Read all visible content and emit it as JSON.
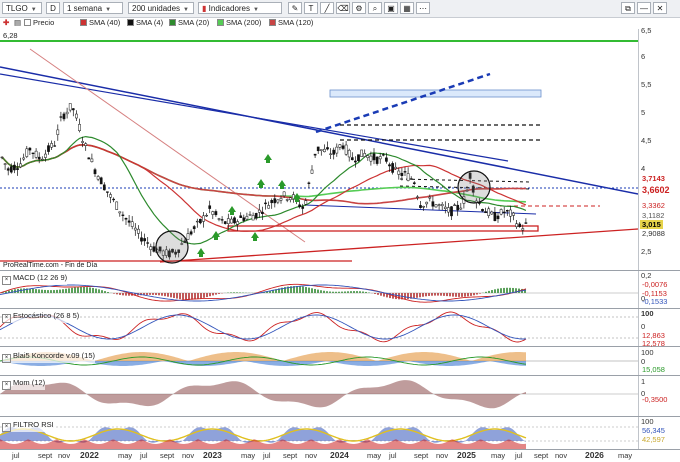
{
  "toolbar": {
    "symbol": "TLGO",
    "period_btn": "D",
    "timeframe": "1 semana",
    "units": "200 unidades",
    "indicators": "Indicadores"
  },
  "legend": [
    {
      "label": "Precio",
      "color": "#ffffff"
    },
    {
      "label": "SMA (40)",
      "color": "#cc3333"
    },
    {
      "label": "SMA (4)",
      "color": "#111111"
    },
    {
      "label": "SMA (20)",
      "color": "#2d8a2d"
    },
    {
      "label": "SMA (200)",
      "color": "#55cc55"
    },
    {
      "label": "SMA (120)",
      "color": "#c84444"
    }
  ],
  "price_label_top": "6,28",
  "source_label": "ProRealTime.com - Fin de Día",
  "right_axis_main": [
    "6,5",
    "6",
    "5,5",
    "5",
    "4,5",
    "4",
    "3,5",
    "2,5"
  ],
  "badges_main": [
    {
      "text": "3,7143",
      "color": "#ffffff",
      "textcolor": "#cc2222"
    },
    {
      "text": "3,6602",
      "color": "#ffffff",
      "textcolor": "#cc2222"
    },
    {
      "text": "3,3362",
      "color": "#ffffff",
      "textcolor": "#cc2222"
    },
    {
      "text": "3,1182",
      "color": "#ffffff",
      "textcolor": "#555555"
    },
    {
      "text": "3,015",
      "color": "#e6d34a",
      "textcolor": "#000000"
    },
    {
      "text": "2,9088",
      "color": "#ffffff",
      "textcolor": "#333333"
    }
  ],
  "panels": {
    "macd": {
      "title": "MACD (12 26 9)",
      "axis": [
        "0,2",
        "0"
      ],
      "vals": [
        "-0,0076",
        "-0,1153",
        "-0,1533"
      ]
    },
    "stoch": {
      "title": "Estocástico (26 8 5)",
      "axis": [
        "100",
        "0"
      ],
      "vals": [
        "12,863",
        "12,578"
      ]
    },
    "blai": {
      "title": "Blai5 Koncorde v.09 (15)",
      "axis": [
        "100",
        "0"
      ],
      "vals": [
        "15,058"
      ]
    },
    "mom": {
      "title": "Mom (12)",
      "axis": [
        "1",
        "0"
      ],
      "vals": [
        "-0,3500"
      ]
    },
    "rsi": {
      "title": "FILTRO RSI",
      "axis": [
        "100"
      ],
      "vals": [
        "56,345",
        "42,597"
      ]
    }
  },
  "xaxis": [
    {
      "t": "jul",
      "b": false
    },
    {
      "t": "sept",
      "b": false
    },
    {
      "t": "nov",
      "b": false
    },
    {
      "t": "2022",
      "b": true
    },
    {
      "t": "may",
      "b": false
    },
    {
      "t": "jul",
      "b": false
    },
    {
      "t": "sept",
      "b": false
    },
    {
      "t": "nov",
      "b": false
    },
    {
      "t": "2023",
      "b": true
    },
    {
      "t": "may",
      "b": false
    },
    {
      "t": "jul",
      "b": false
    },
    {
      "t": "sept",
      "b": false
    },
    {
      "t": "nov",
      "b": false
    },
    {
      "t": "2024",
      "b": true
    },
    {
      "t": "may",
      "b": false
    },
    {
      "t": "jul",
      "b": false
    },
    {
      "t": "sept",
      "b": false
    },
    {
      "t": "nov",
      "b": false
    },
    {
      "t": "2025",
      "b": true
    },
    {
      "t": "may",
      "b": false
    },
    {
      "t": "jul",
      "b": false
    },
    {
      "t": "sept",
      "b": false
    },
    {
      "t": "nov",
      "b": false
    },
    {
      "t": "2026",
      "b": true
    },
    {
      "t": "may",
      "b": false
    }
  ],
  "chart_data": {
    "type": "line",
    "title": "TLGO",
    "x": [
      "2021-06",
      "2021-09",
      "2021-12",
      "2022-03",
      "2022-06",
      "2022-09",
      "2022-12",
      "2023-03",
      "2023-06",
      "2023-09",
      "2023-12",
      "2024-03",
      "2024-06",
      "2024-09",
      "2024-12",
      "2025-03",
      "2025-06",
      "2025-07"
    ],
    "series": [
      {
        "name": "Precio",
        "values": [
          4.5,
          4.2,
          4.0,
          5.2,
          3.3,
          2.6,
          3.1,
          3.4,
          3.1,
          3.4,
          4.2,
          4.5,
          4.3,
          3.7,
          3.5,
          3.4,
          3.0,
          3.015
        ]
      }
    ],
    "ylim": [
      2.3,
      6.6
    ]
  }
}
